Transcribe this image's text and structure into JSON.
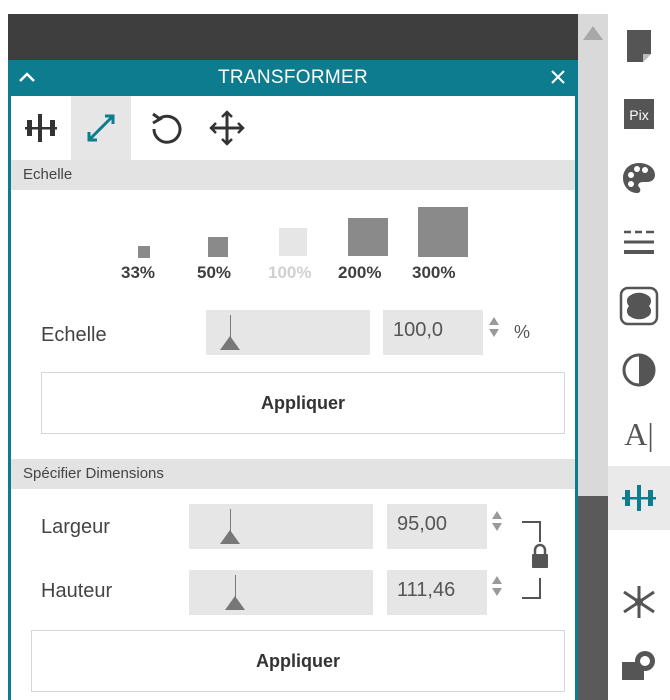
{
  "panel": {
    "title": "TRANSFORMER",
    "tabs": [
      "align-icon",
      "scale-icon",
      "rotate-icon",
      "move-icon"
    ],
    "active_tab": "scale-icon"
  },
  "scale_section": {
    "header": "Echelle",
    "presets": [
      {
        "label": "33%",
        "enabled": true
      },
      {
        "label": "50%",
        "enabled": true
      },
      {
        "label": "100%",
        "enabled": false
      },
      {
        "label": "200%",
        "enabled": true
      },
      {
        "label": "300%",
        "enabled": true
      }
    ],
    "scale_label": "Echelle",
    "scale_value": "100,0",
    "scale_unit": "%",
    "apply_label": "Appliquer"
  },
  "dimensions_section": {
    "header": "Spécifier Dimensions",
    "width_label": "Largeur",
    "width_value": "95,00",
    "height_label": "Hauteur",
    "height_value": "111,46",
    "apply_label": "Appliquer"
  },
  "right_toolbar": {
    "items": [
      "page-setup-icon",
      "pixscan-icon",
      "palette-icon",
      "line-style-icon",
      "offset-icon",
      "fill-icon",
      "text-style-icon",
      "transform-icon",
      "replicate-icon",
      "modify-icon"
    ],
    "pix_text": "Pix",
    "text_glyph": "A|",
    "active_item": "transform-icon"
  },
  "colors": {
    "accent": "#0d7c8f",
    "dark_band": "#3e3e3e",
    "section_bg": "#e3e3e3"
  }
}
